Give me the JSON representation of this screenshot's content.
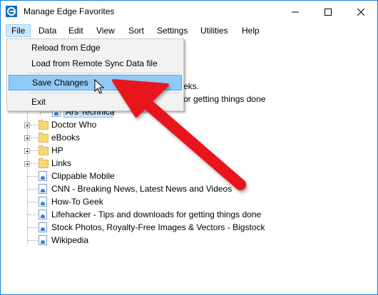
{
  "window": {
    "title": "Manage Edge Favorites"
  },
  "menubar": {
    "items": [
      "File",
      "Data",
      "Edit",
      "View",
      "Sort",
      "Settings",
      "Utilities",
      "Help"
    ]
  },
  "file_menu": {
    "items": [
      "Reload from Edge",
      "Load from Remote Sync Data file",
      "Save Changes",
      "Exit"
    ]
  },
  "tree": {
    "partial_rows": [
      "eks.",
      "or getting things done",
      "Ars Technica"
    ],
    "folders": [
      "Doctor Who",
      "eBooks",
      "HP",
      "Links"
    ],
    "links": [
      "Clippable Mobile",
      "CNN - Breaking News, Latest News and Videos",
      "How-To Geek",
      "Lifehacker - Tips and downloads for getting things done",
      "Stock Photos, Royalty-Free Images & Vectors - Bigstock",
      "Wikipedia"
    ]
  },
  "colors": {
    "window_border": "#1883d7",
    "menu_highlight": "#91c9f7",
    "arrow": "#e8171c"
  }
}
